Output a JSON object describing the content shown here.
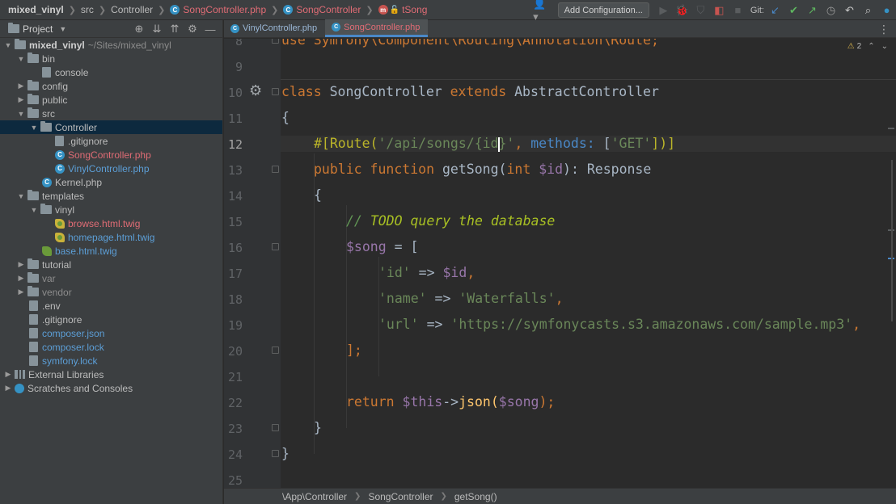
{
  "nav": {
    "project": "mixed_vinyl",
    "crumbs": [
      "src",
      "Controller",
      "SongController.php",
      "SongController",
      "tSong"
    ],
    "add_configuration": "Add Configuration...",
    "git_label": "Git:"
  },
  "project_panel": {
    "title": "Project",
    "tree": [
      {
        "label": "mixed_vinyl",
        "path": "~/Sites/mixed_vinyl"
      },
      {
        "label": "bin"
      },
      {
        "label": "console"
      },
      {
        "label": "config"
      },
      {
        "label": "public"
      },
      {
        "label": "src"
      },
      {
        "label": "Controller"
      },
      {
        "label": ".gitignore"
      },
      {
        "label": "SongController.php"
      },
      {
        "label": "VinylController.php"
      },
      {
        "label": "Kernel.php"
      },
      {
        "label": "templates"
      },
      {
        "label": "vinyl"
      },
      {
        "label": "browse.html.twig"
      },
      {
        "label": "homepage.html.twig"
      },
      {
        "label": "base.html.twig"
      },
      {
        "label": "tutorial"
      },
      {
        "label": "var"
      },
      {
        "label": "vendor"
      },
      {
        "label": ".env"
      },
      {
        "label": ".gitignore"
      },
      {
        "label": "composer.json"
      },
      {
        "label": "composer.lock"
      },
      {
        "label": "symfony.lock"
      },
      {
        "label": "External Libraries"
      },
      {
        "label": "Scratches and Consoles"
      }
    ]
  },
  "tabs": [
    {
      "label": "VinylController.php",
      "active": false
    },
    {
      "label": "SongController.php",
      "active": true
    }
  ],
  "editor": {
    "warnings": "2",
    "line_numbers": [
      "8",
      "9",
      "10",
      "11",
      "12",
      "13",
      "14",
      "15",
      "16",
      "17",
      "18",
      "19",
      "20",
      "21",
      "22",
      "23",
      "24",
      "25"
    ],
    "current_line": "12",
    "tokens": {
      "l8": "use Symfony\\Component\\Routing\\Annotation\\Route;",
      "class_kw": "class",
      "class_name": "SongController",
      "extends_kw": "extends",
      "parent": "AbstractController",
      "brace_open": "{",
      "attr_open": "#[Route(",
      "route_path_a": "'/api/songs/{id",
      "route_path_b": "}'",
      "comma": ",",
      "methods": "methods:",
      "methods_val_open": "[",
      "methods_val": "'GET'",
      "attr_close": "])]",
      "public_kw": "public",
      "function_kw": "function",
      "method_name": "getSong",
      "paren_open": "(",
      "int_kw": "int",
      "id_var": "$id",
      "sig_close": "):",
      "return_type": "Response",
      "inner_brace_open": "{",
      "comment_prefix": "// ",
      "comment_todo": "TODO",
      "comment_text": " query the database",
      "song_var": "$song",
      "assign": " = [",
      "key_id": "'id'",
      "arrow": " => ",
      "val_id": "$id",
      "key_name": "'name'",
      "val_name": "'Waterfalls'",
      "key_url": "'url'",
      "val_url": "'https://symfonycasts.s3.amazonaws.com/sample.mp3'",
      "arr_close": "];",
      "return_kw": "return",
      "this_var": "$this",
      "arrow_call": "->",
      "json_fn": "json",
      "song_arg": "$song",
      "ret_close": ");",
      "inner_brace_close": "}",
      "brace_close": "}"
    }
  },
  "status_breadcrumb": [
    "\\App\\Controller",
    "SongController",
    "getSong()"
  ]
}
